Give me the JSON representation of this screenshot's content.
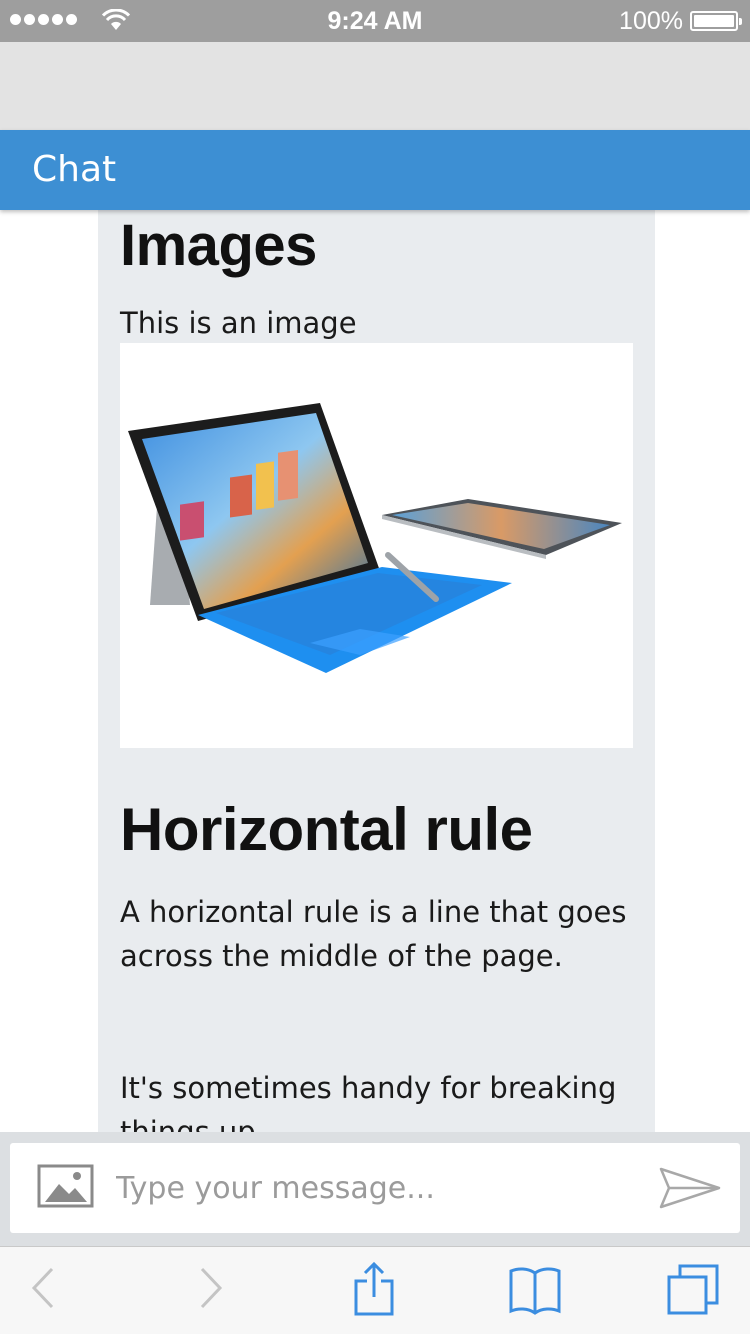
{
  "status_bar": {
    "time": "9:24 AM",
    "battery_percent": "100%",
    "signal_bars": 5,
    "battery_level": 1.0
  },
  "header": {
    "title": "Chat"
  },
  "content": {
    "images_heading": "Images",
    "image_caption": "This is an image",
    "image_icon": "laptop-tablet-photo",
    "rule_heading": "Horizontal rule",
    "rule_paragraph": "A horizontal rule is a line that goes across the middle of the page.",
    "breaking_paragraph": "It's sometimes handy for breaking things up."
  },
  "composer": {
    "placeholder": "Type your message...",
    "value": "",
    "attach_icon": "image-icon",
    "send_icon": "send-icon"
  },
  "toolbar": {
    "icons": [
      "back-icon",
      "forward-icon",
      "share-icon",
      "bookmarks-icon",
      "tabs-icon"
    ]
  },
  "colors": {
    "header_bg": "#3d8fd3",
    "status_bar_bg": "#9e9e9e",
    "card_bg": "#e9ecef",
    "toolbar_icon": "#3b8de0"
  }
}
